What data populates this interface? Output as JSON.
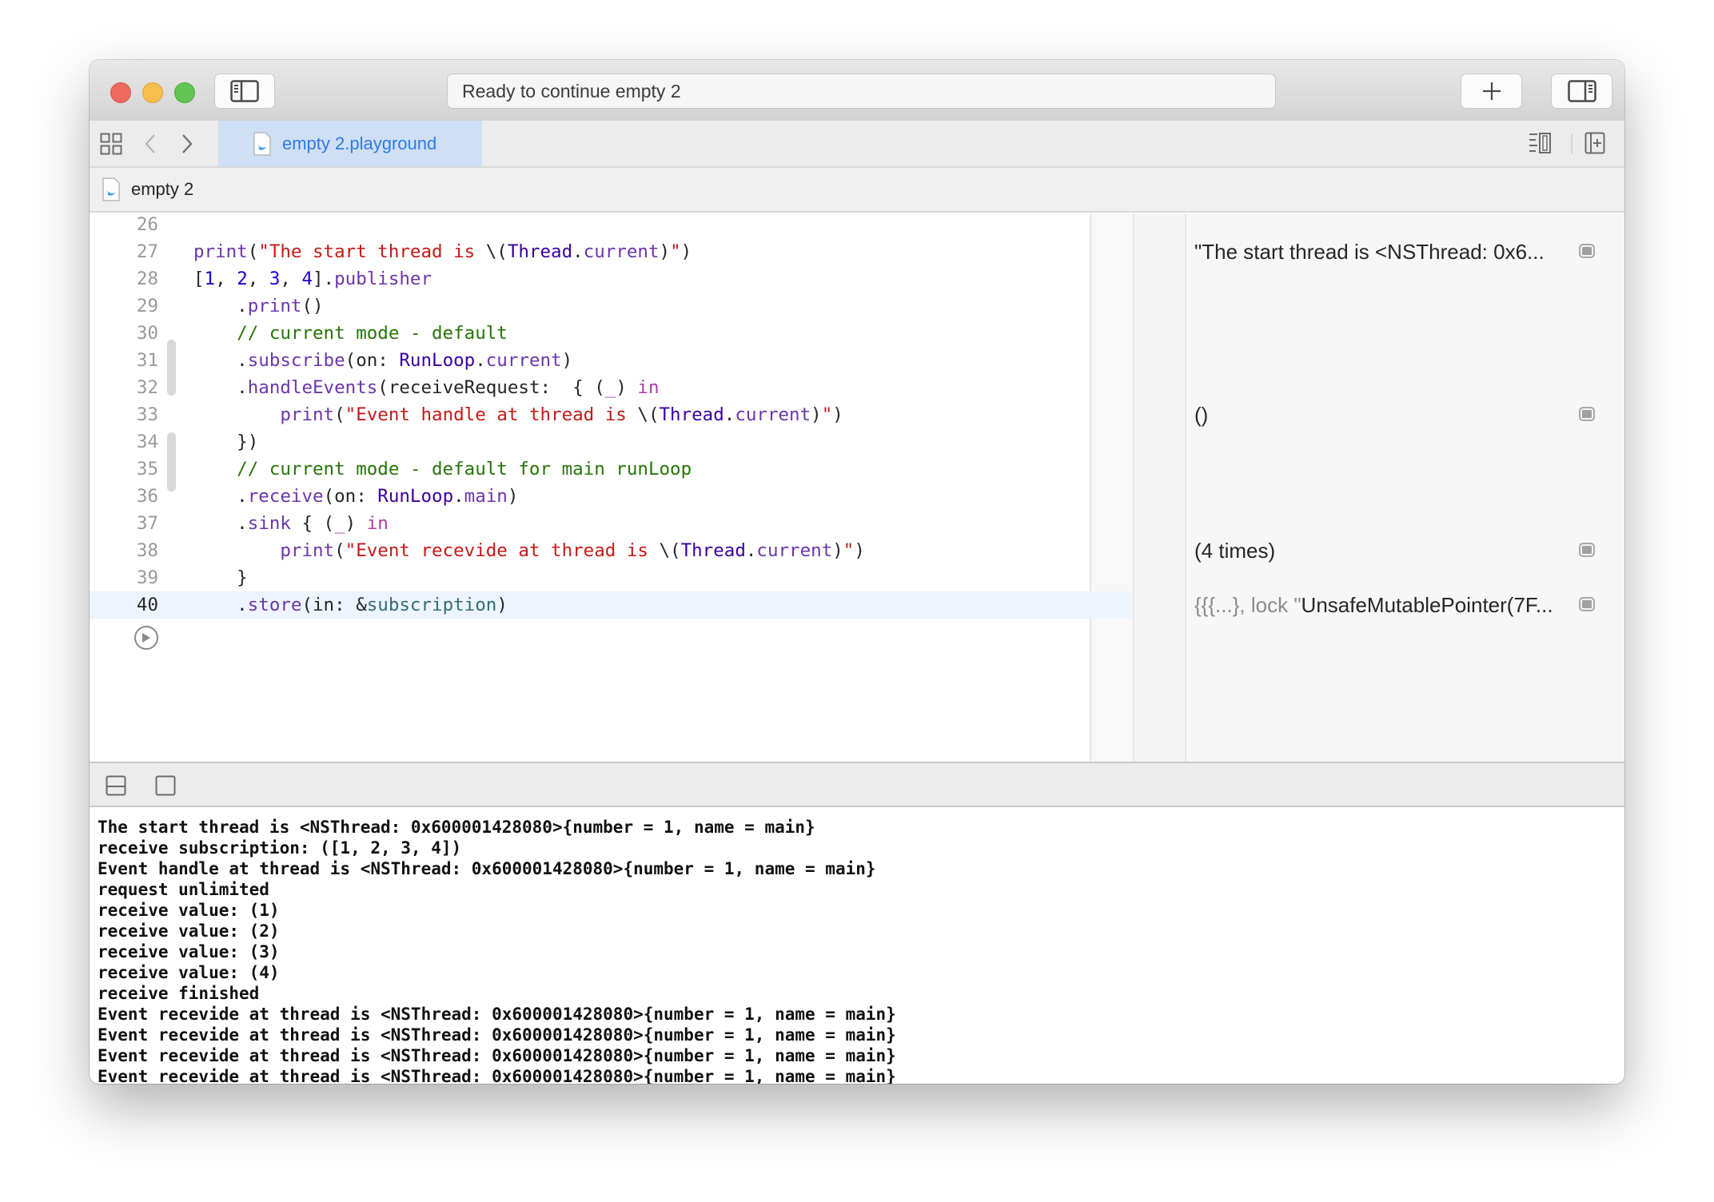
{
  "window": {
    "status_text": "Ready to continue empty 2",
    "buttons": {
      "navigator_toggle": "sidebar-left-icon",
      "library": "plus-icon",
      "inspector_toggle": "sidebar-right-icon"
    }
  },
  "tabbar": {
    "active_tab": "empty 2.playground",
    "nav_back": "chevron-left-icon",
    "nav_forward": "chevron-right-icon"
  },
  "jumpbar": {
    "item": "empty 2"
  },
  "editor": {
    "current_line": 40,
    "lines": [
      {
        "n": "26",
        "tokens": []
      },
      {
        "n": "27",
        "tokens": [
          [
            "c-fn",
            "print"
          ],
          [
            "c-plain",
            "("
          ],
          [
            "c-str",
            "\"The start thread is "
          ],
          [
            "c-plain",
            "\\("
          ],
          [
            "c-type",
            "Thread"
          ],
          [
            "c-plain",
            "."
          ],
          [
            "c-fn",
            "current"
          ],
          [
            "c-plain",
            ")"
          ],
          [
            "c-str",
            "\""
          ],
          [
            "c-plain",
            ")"
          ]
        ]
      },
      {
        "n": "28",
        "tokens": [
          [
            "c-plain",
            "["
          ],
          [
            "c-num",
            "1"
          ],
          [
            "c-plain",
            ", "
          ],
          [
            "c-num",
            "2"
          ],
          [
            "c-plain",
            ", "
          ],
          [
            "c-num",
            "3"
          ],
          [
            "c-plain",
            ", "
          ],
          [
            "c-num",
            "4"
          ],
          [
            "c-plain",
            "]."
          ],
          [
            "c-fn",
            "publisher"
          ]
        ]
      },
      {
        "n": "29",
        "tokens": [
          [
            "c-plain",
            "    ."
          ],
          [
            "c-fn",
            "print"
          ],
          [
            "c-plain",
            "()"
          ]
        ]
      },
      {
        "n": "30",
        "tokens": [
          [
            "c-cmt",
            "    // current mode - default"
          ]
        ]
      },
      {
        "n": "31",
        "tokens": [
          [
            "c-plain",
            "    ."
          ],
          [
            "c-fn",
            "subscribe"
          ],
          [
            "c-plain",
            "(on: "
          ],
          [
            "c-type",
            "RunLoop"
          ],
          [
            "c-plain",
            "."
          ],
          [
            "c-fn",
            "current"
          ],
          [
            "c-plain",
            ")"
          ]
        ]
      },
      {
        "n": "32",
        "tokens": [
          [
            "c-plain",
            "    ."
          ],
          [
            "c-fn",
            "handleEvents"
          ],
          [
            "c-plain",
            "(receiveRequest:  { ("
          ],
          [
            "c-kw",
            "_"
          ],
          [
            "c-plain",
            ") "
          ],
          [
            "c-kw",
            "in"
          ]
        ]
      },
      {
        "n": "33",
        "tokens": [
          [
            "c-plain",
            "        "
          ],
          [
            "c-fn",
            "print"
          ],
          [
            "c-plain",
            "("
          ],
          [
            "c-str",
            "\"Event handle at thread is "
          ],
          [
            "c-plain",
            "\\("
          ],
          [
            "c-type",
            "Thread"
          ],
          [
            "c-plain",
            "."
          ],
          [
            "c-fn",
            "current"
          ],
          [
            "c-plain",
            ")"
          ],
          [
            "c-str",
            "\""
          ],
          [
            "c-plain",
            ")"
          ]
        ]
      },
      {
        "n": "34",
        "tokens": [
          [
            "c-plain",
            "    })"
          ]
        ]
      },
      {
        "n": "35",
        "tokens": [
          [
            "c-cmt",
            "    // current mode - default for main runLoop"
          ]
        ]
      },
      {
        "n": "36",
        "tokens": [
          [
            "c-plain",
            "    ."
          ],
          [
            "c-fn",
            "receive"
          ],
          [
            "c-plain",
            "(on: "
          ],
          [
            "c-type",
            "RunLoop"
          ],
          [
            "c-plain",
            "."
          ],
          [
            "c-fn",
            "main"
          ],
          [
            "c-plain",
            ")"
          ]
        ]
      },
      {
        "n": "37",
        "tokens": [
          [
            "c-plain",
            "    ."
          ],
          [
            "c-fn",
            "sink"
          ],
          [
            "c-plain",
            " { ("
          ],
          [
            "c-kw",
            "_"
          ],
          [
            "c-plain",
            ") "
          ],
          [
            "c-kw",
            "in"
          ]
        ]
      },
      {
        "n": "38",
        "tokens": [
          [
            "c-plain",
            "        "
          ],
          [
            "c-fn",
            "print"
          ],
          [
            "c-plain",
            "("
          ],
          [
            "c-str",
            "\"Event recevide at thread is "
          ],
          [
            "c-plain",
            "\\("
          ],
          [
            "c-type",
            "Thread"
          ],
          [
            "c-plain",
            "."
          ],
          [
            "c-fn",
            "current"
          ],
          [
            "c-plain",
            ")"
          ],
          [
            "c-str",
            "\""
          ],
          [
            "c-plain",
            ")"
          ]
        ]
      },
      {
        "n": "39",
        "tokens": [
          [
            "c-plain",
            "    }"
          ]
        ]
      },
      {
        "n": "40",
        "tokens": [
          [
            "c-plain",
            "    ."
          ],
          [
            "c-fn",
            "store"
          ],
          [
            "c-plain",
            "(in: &"
          ],
          [
            "c-var",
            "subscription"
          ],
          [
            "c-plain",
            ")"
          ]
        ]
      }
    ],
    "run_button": "play-icon"
  },
  "results": [
    {
      "line": 27,
      "dim": "",
      "text": "\"The start thread is <NSThread: 0x6..."
    },
    {
      "line": 33,
      "dim": "",
      "text": "()"
    },
    {
      "line": 38,
      "dim": "",
      "text": "(4 times)"
    },
    {
      "line": 40,
      "dim": "{{{...}, lock \"",
      "text": "UnsafeMutablePointer(7F..."
    }
  ],
  "debugbar": {
    "hide_debug_area": "panel-bottom-icon",
    "show_variables": "square-icon"
  },
  "console": {
    "lines": [
      "The start thread is <NSThread: 0x600001428080>{number = 1, name = main}",
      "receive subscription: ([1, 2, 3, 4])",
      "Event handle at thread is <NSThread: 0x600001428080>{number = 1, name = main}",
      "request unlimited",
      "receive value: (1)",
      "receive value: (2)",
      "receive value: (3)",
      "receive value: (4)",
      "receive finished",
      "Event recevide at thread is <NSThread: 0x600001428080>{number = 1, name = main}",
      "Event recevide at thread is <NSThread: 0x600001428080>{number = 1, name = main}",
      "Event recevide at thread is <NSThread: 0x600001428080>{number = 1, name = main}",
      "Event recevide at thread is <NSThread: 0x600001428080>{number = 1, name = main}"
    ]
  }
}
